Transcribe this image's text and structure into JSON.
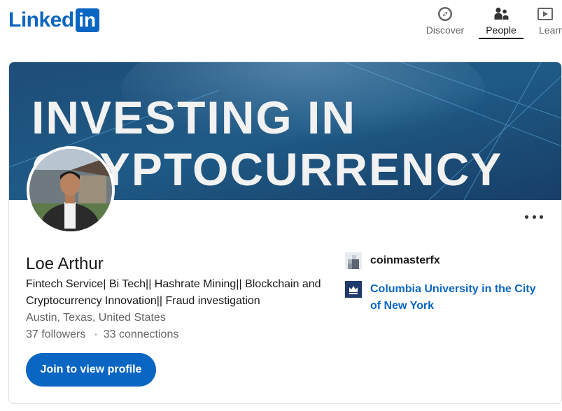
{
  "brand": {
    "logo_text": "Linked",
    "logo_box": "in",
    "color": "#0a66c2"
  },
  "nav": [
    {
      "label": "Discover",
      "icon": "compass-icon",
      "active": false
    },
    {
      "label": "People",
      "icon": "people-icon",
      "active": true
    },
    {
      "label": "Learn",
      "icon": "video-icon",
      "active": false
    }
  ],
  "cover": {
    "text_line1": "INVESTING IN",
    "text_line2": "CRYPTOCURRENCY"
  },
  "profile": {
    "name": "Loe Arthur",
    "headline": "Fintech Service| Bi Tech|| Hashrate Mining|| Blockchain and Cryptocurrency Innovation|| Fraud investigation",
    "location": "Austin, Texas, United States",
    "followers": "37 followers",
    "separator": "·",
    "connections": "33 connections",
    "join_button": "Join to view profile"
  },
  "affiliations": [
    {
      "name": "coinmasterfx",
      "icon": "company-logo-icon"
    },
    {
      "name": "Columbia University in the City of New York",
      "icon": "university-crown-icon"
    }
  ]
}
